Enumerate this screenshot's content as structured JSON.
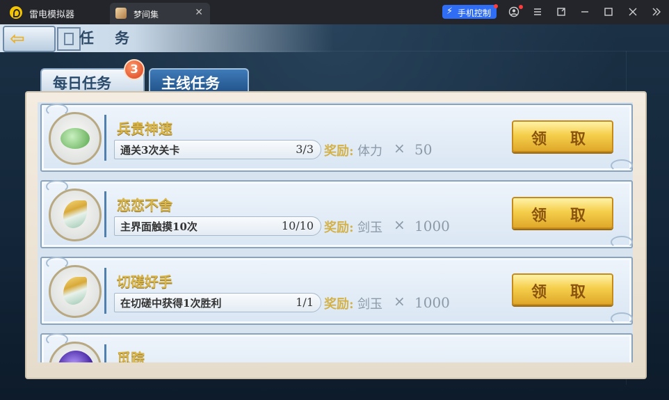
{
  "emulator": {
    "app_name": "雷电模拟器",
    "tab_title": "梦间集",
    "tab_close": "✕",
    "phone_control": "手机控制",
    "icons": [
      "account-icon",
      "menu-icon",
      "popout-icon",
      "minimize-icon",
      "maximize-icon",
      "close-icon",
      "expand-icon"
    ]
  },
  "game": {
    "page_title": "任务",
    "tabs": [
      {
        "label": "每日任务",
        "badge": "3"
      },
      {
        "label": "主线任务"
      }
    ],
    "tasks": [
      {
        "name": "兵贵神速",
        "condition": "通关3次关卡",
        "progress": "3/3",
        "reward_label": "奖励:",
        "reward_item": "体力",
        "times": "×",
        "quantity": "50",
        "button": "领取"
      },
      {
        "name": "恋恋不舍",
        "condition": "主界面触摸10次",
        "progress": "10/10",
        "reward_label": "奖励:",
        "reward_item": "剑玉",
        "times": "×",
        "quantity": "1000",
        "button": "领取"
      },
      {
        "name": "切磋好手",
        "condition": "在切磋中获得1次胜利",
        "progress": "1/1",
        "reward_label": "奖励:",
        "reward_item": "剑玉",
        "times": "×",
        "quantity": "1000",
        "button": "领取"
      },
      {
        "name": "觅踪"
      }
    ]
  }
}
